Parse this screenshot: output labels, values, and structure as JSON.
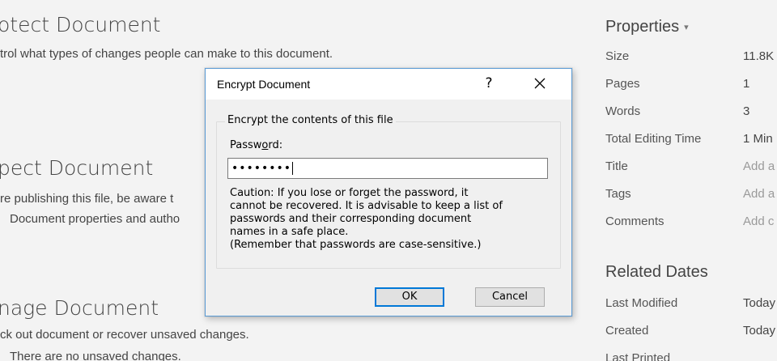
{
  "sections": {
    "protect": {
      "title": "otect Document",
      "desc": "trol what types of changes people can make to this document."
    },
    "inspect": {
      "title": "pect Document",
      "desc1": "re publishing this file, be aware t",
      "desc2": "Document properties and autho"
    },
    "manage": {
      "title": "nage Document",
      "desc1": "ck out document or recover unsaved changes.",
      "desc2": "There are no unsaved changes."
    }
  },
  "properties": {
    "title": "Properties",
    "rows": [
      {
        "label": "Size",
        "value": "11.8K"
      },
      {
        "label": "Pages",
        "value": "1"
      },
      {
        "label": "Words",
        "value": "3"
      },
      {
        "label": "Total Editing Time",
        "value": "1 Min"
      },
      {
        "label": "Title",
        "value": "Add a"
      },
      {
        "label": "Tags",
        "value": "Add a"
      },
      {
        "label": "Comments",
        "value": "Add c"
      }
    ]
  },
  "related_dates": {
    "title": "Related Dates",
    "rows": [
      {
        "label": "Last Modified",
        "value": "Today"
      },
      {
        "label": "Created",
        "value": "Today"
      },
      {
        "label": "Last Printed",
        "value": ""
      }
    ]
  },
  "dialog": {
    "title": "Encrypt Document",
    "help": "?",
    "group_legend": "Encrypt the contents of this file",
    "password_label_pre": "Passw",
    "password_label_key": "o",
    "password_label_post": "rd:",
    "password_value": "••••••••",
    "caution_lines": [
      "Caution: If you lose or forget the password, it",
      "cannot be recovered. It is advisable to keep a list of",
      "passwords and their corresponding document",
      "names in a safe place.",
      "(Remember that passwords are case-sensitive.)"
    ],
    "ok_label": "OK",
    "cancel_label": "Cancel"
  }
}
